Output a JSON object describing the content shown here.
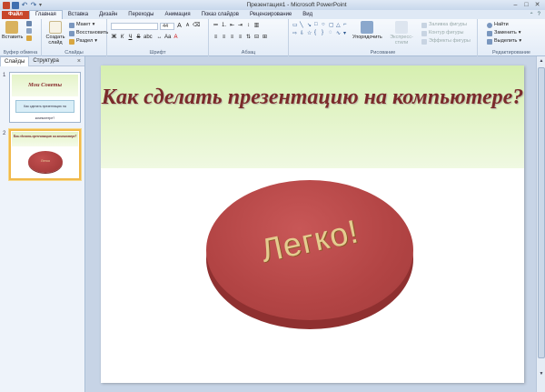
{
  "window": {
    "title": "Презентация1 - Microsoft PowerPoint",
    "controls": {
      "minimize": "–",
      "maximize": "□",
      "close": "✕"
    }
  },
  "tabs": {
    "file": "Файл",
    "items": [
      "Главная",
      "Вставка",
      "Дизайн",
      "Переходы",
      "Анимация",
      "Показ слайдов",
      "Рецензирование",
      "Вид"
    ],
    "active": "Главная"
  },
  "ribbon": {
    "clipboard": {
      "paste": "Вставить",
      "label": "Буфер обмена"
    },
    "slides": {
      "new_slide": "Создать слайд",
      "layout": "Макет",
      "reset": "Восстановить",
      "section": "Раздел",
      "label": "Слайды"
    },
    "font": {
      "label": "Шрифт",
      "size_value": "44",
      "bold": "Ж",
      "italic": "К",
      "underline": "Ч",
      "strike": "S",
      "grow": "A",
      "shrink": "A"
    },
    "paragraph": {
      "label": "Абзац"
    },
    "drawing": {
      "arrange": "Упорядочить",
      "quick_styles": "Экспресс-стили",
      "fill": "Заливка фигуры",
      "outline": "Контур фигуры",
      "effects": "Эффекты фигуры",
      "label": "Рисование"
    },
    "editing": {
      "find": "Найти",
      "replace": "Заменить",
      "select": "Выделить",
      "label": "Редактирование"
    }
  },
  "panel": {
    "tabs": [
      "Слайды",
      "Структура"
    ],
    "close": "×",
    "slides": [
      {
        "number": "1",
        "title": "Мои Советы",
        "body": "Как сделать презентацию на компьютере?"
      },
      {
        "number": "2",
        "title": "Как сделать презентацию на компьютере?",
        "shape_text": "Легко"
      }
    ]
  },
  "slide": {
    "title": "Как сделать презентацию на компьютере?",
    "shape_text": "Легко!"
  },
  "colors": {
    "file_tab": "#c8462a",
    "title_text": "#7b2b2b",
    "oval_fill": "#b24444",
    "oval_text": "#e4cc8f",
    "header_fill": "#d6efb0"
  }
}
